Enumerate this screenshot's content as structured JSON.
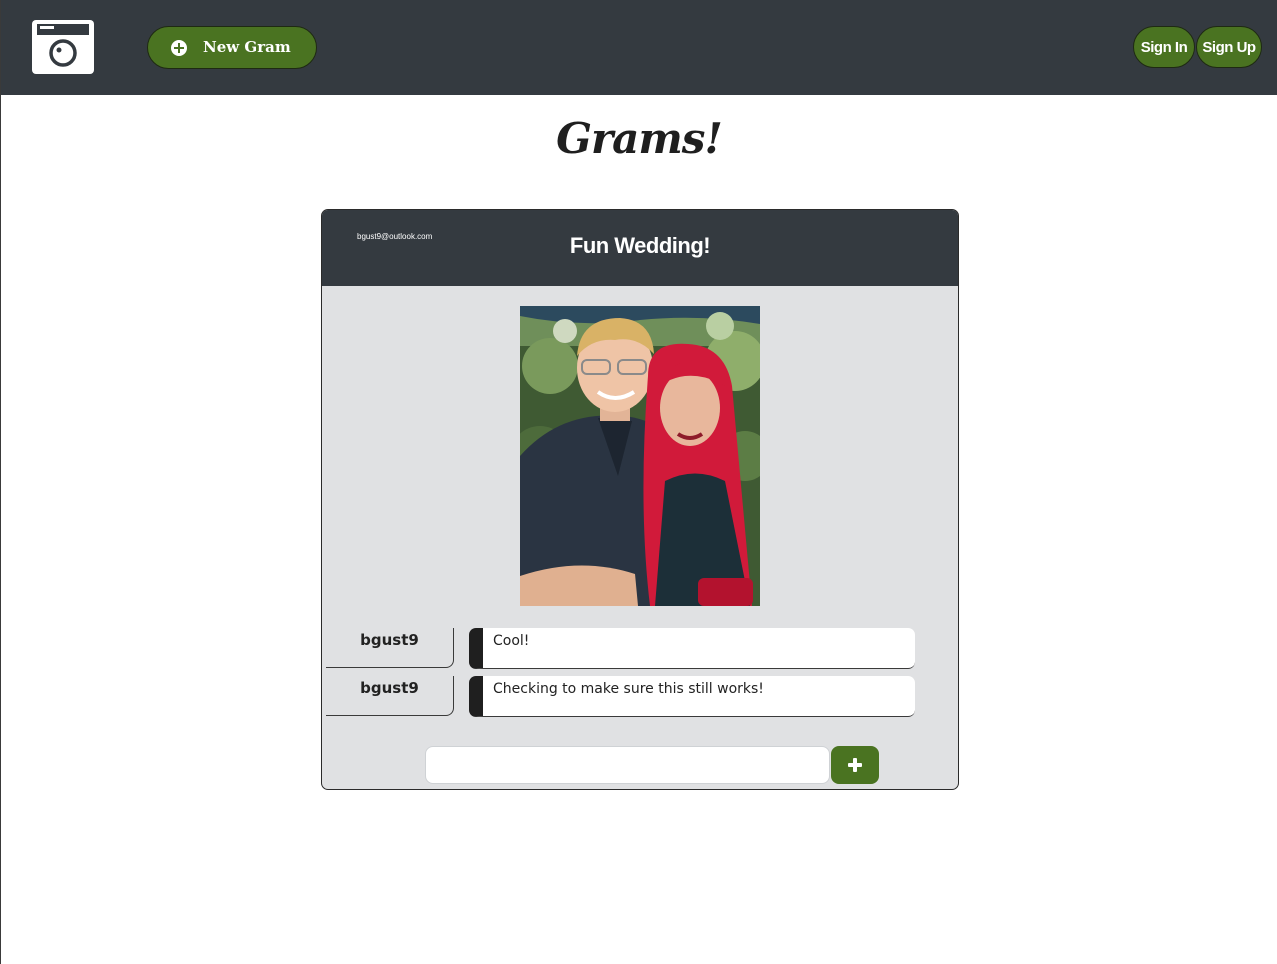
{
  "nav": {
    "logo_icon": "camera-icon",
    "new_gram_icon": "plus-circle-icon",
    "new_gram_label": "New Gram",
    "sign_in_label": "Sign In",
    "sign_up_label": "Sign Up"
  },
  "page": {
    "title": "Grams!"
  },
  "gram": {
    "author_email": "bgust9@outlook.com",
    "title": "Fun Wedding!",
    "comments": [
      {
        "author": "bgust9",
        "text": "Cool!"
      },
      {
        "author": "bgust9",
        "text": "Checking to make sure this still works!"
      }
    ],
    "comment_input": {
      "value": "",
      "placeholder": ""
    },
    "add_comment_icon": "plus-icon"
  },
  "colors": {
    "navbar": "#343a40",
    "accent_green": "#4a7321",
    "card_background": "#e0e1e3"
  }
}
